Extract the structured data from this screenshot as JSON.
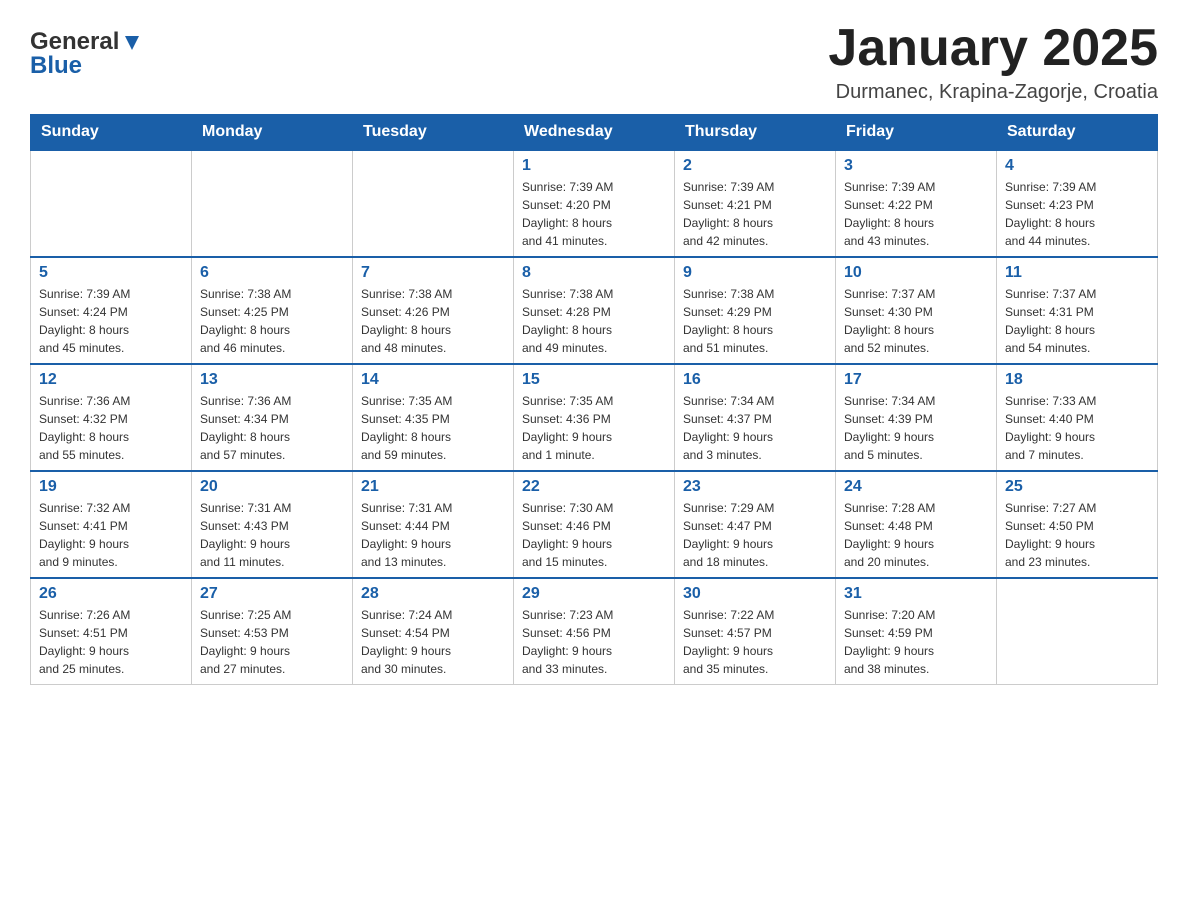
{
  "header": {
    "logo_general": "General",
    "logo_blue": "Blue",
    "month_title": "January 2025",
    "location": "Durmanec, Krapina-Zagorje, Croatia"
  },
  "calendar": {
    "days_of_week": [
      "Sunday",
      "Monday",
      "Tuesday",
      "Wednesday",
      "Thursday",
      "Friday",
      "Saturday"
    ],
    "weeks": [
      [
        {
          "day": "",
          "info": ""
        },
        {
          "day": "",
          "info": ""
        },
        {
          "day": "",
          "info": ""
        },
        {
          "day": "1",
          "info": "Sunrise: 7:39 AM\nSunset: 4:20 PM\nDaylight: 8 hours\nand 41 minutes."
        },
        {
          "day": "2",
          "info": "Sunrise: 7:39 AM\nSunset: 4:21 PM\nDaylight: 8 hours\nand 42 minutes."
        },
        {
          "day": "3",
          "info": "Sunrise: 7:39 AM\nSunset: 4:22 PM\nDaylight: 8 hours\nand 43 minutes."
        },
        {
          "day": "4",
          "info": "Sunrise: 7:39 AM\nSunset: 4:23 PM\nDaylight: 8 hours\nand 44 minutes."
        }
      ],
      [
        {
          "day": "5",
          "info": "Sunrise: 7:39 AM\nSunset: 4:24 PM\nDaylight: 8 hours\nand 45 minutes."
        },
        {
          "day": "6",
          "info": "Sunrise: 7:38 AM\nSunset: 4:25 PM\nDaylight: 8 hours\nand 46 minutes."
        },
        {
          "day": "7",
          "info": "Sunrise: 7:38 AM\nSunset: 4:26 PM\nDaylight: 8 hours\nand 48 minutes."
        },
        {
          "day": "8",
          "info": "Sunrise: 7:38 AM\nSunset: 4:28 PM\nDaylight: 8 hours\nand 49 minutes."
        },
        {
          "day": "9",
          "info": "Sunrise: 7:38 AM\nSunset: 4:29 PM\nDaylight: 8 hours\nand 51 minutes."
        },
        {
          "day": "10",
          "info": "Sunrise: 7:37 AM\nSunset: 4:30 PM\nDaylight: 8 hours\nand 52 minutes."
        },
        {
          "day": "11",
          "info": "Sunrise: 7:37 AM\nSunset: 4:31 PM\nDaylight: 8 hours\nand 54 minutes."
        }
      ],
      [
        {
          "day": "12",
          "info": "Sunrise: 7:36 AM\nSunset: 4:32 PM\nDaylight: 8 hours\nand 55 minutes."
        },
        {
          "day": "13",
          "info": "Sunrise: 7:36 AM\nSunset: 4:34 PM\nDaylight: 8 hours\nand 57 minutes."
        },
        {
          "day": "14",
          "info": "Sunrise: 7:35 AM\nSunset: 4:35 PM\nDaylight: 8 hours\nand 59 minutes."
        },
        {
          "day": "15",
          "info": "Sunrise: 7:35 AM\nSunset: 4:36 PM\nDaylight: 9 hours\nand 1 minute."
        },
        {
          "day": "16",
          "info": "Sunrise: 7:34 AM\nSunset: 4:37 PM\nDaylight: 9 hours\nand 3 minutes."
        },
        {
          "day": "17",
          "info": "Sunrise: 7:34 AM\nSunset: 4:39 PM\nDaylight: 9 hours\nand 5 minutes."
        },
        {
          "day": "18",
          "info": "Sunrise: 7:33 AM\nSunset: 4:40 PM\nDaylight: 9 hours\nand 7 minutes."
        }
      ],
      [
        {
          "day": "19",
          "info": "Sunrise: 7:32 AM\nSunset: 4:41 PM\nDaylight: 9 hours\nand 9 minutes."
        },
        {
          "day": "20",
          "info": "Sunrise: 7:31 AM\nSunset: 4:43 PM\nDaylight: 9 hours\nand 11 minutes."
        },
        {
          "day": "21",
          "info": "Sunrise: 7:31 AM\nSunset: 4:44 PM\nDaylight: 9 hours\nand 13 minutes."
        },
        {
          "day": "22",
          "info": "Sunrise: 7:30 AM\nSunset: 4:46 PM\nDaylight: 9 hours\nand 15 minutes."
        },
        {
          "day": "23",
          "info": "Sunrise: 7:29 AM\nSunset: 4:47 PM\nDaylight: 9 hours\nand 18 minutes."
        },
        {
          "day": "24",
          "info": "Sunrise: 7:28 AM\nSunset: 4:48 PM\nDaylight: 9 hours\nand 20 minutes."
        },
        {
          "day": "25",
          "info": "Sunrise: 7:27 AM\nSunset: 4:50 PM\nDaylight: 9 hours\nand 23 minutes."
        }
      ],
      [
        {
          "day": "26",
          "info": "Sunrise: 7:26 AM\nSunset: 4:51 PM\nDaylight: 9 hours\nand 25 minutes."
        },
        {
          "day": "27",
          "info": "Sunrise: 7:25 AM\nSunset: 4:53 PM\nDaylight: 9 hours\nand 27 minutes."
        },
        {
          "day": "28",
          "info": "Sunrise: 7:24 AM\nSunset: 4:54 PM\nDaylight: 9 hours\nand 30 minutes."
        },
        {
          "day": "29",
          "info": "Sunrise: 7:23 AM\nSunset: 4:56 PM\nDaylight: 9 hours\nand 33 minutes."
        },
        {
          "day": "30",
          "info": "Sunrise: 7:22 AM\nSunset: 4:57 PM\nDaylight: 9 hours\nand 35 minutes."
        },
        {
          "day": "31",
          "info": "Sunrise: 7:20 AM\nSunset: 4:59 PM\nDaylight: 9 hours\nand 38 minutes."
        },
        {
          "day": "",
          "info": ""
        }
      ]
    ]
  }
}
